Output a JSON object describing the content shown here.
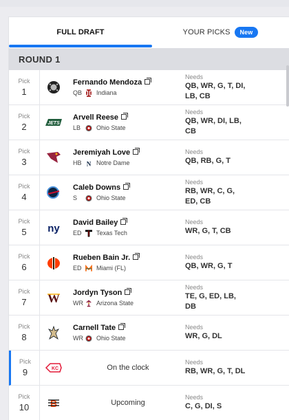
{
  "tabs": {
    "full_draft": "FULL DRAFT",
    "your_picks": "YOUR PICKS",
    "new_badge": "New"
  },
  "round_label": "ROUND 1",
  "pick_label": "Pick",
  "needs_label": "Needs",
  "picks": [
    {
      "num": "1",
      "team_icon": "raiders-logo",
      "name": "Fernando Mendoza",
      "pos": "QB",
      "school": "Indiana",
      "school_icon": "indiana-logo",
      "needs": "QB, WR, G, T, DI, LB, CB"
    },
    {
      "num": "2",
      "team_icon": "jets-logo",
      "name": "Arvell Reese",
      "pos": "LB",
      "school": "Ohio State",
      "school_icon": "ohio-state-logo",
      "needs": "QB, WR, DI, LB, CB"
    },
    {
      "num": "3",
      "team_icon": "cardinals-logo",
      "name": "Jeremiyah Love",
      "pos": "HB",
      "school": "Notre Dame",
      "school_icon": "notre-dame-logo",
      "needs": "QB, RB, G, T"
    },
    {
      "num": "4",
      "team_icon": "titans-logo",
      "name": "Caleb Downs",
      "pos": "S",
      "school": "Ohio State",
      "school_icon": "ohio-state-logo",
      "needs": "RB, WR, C, G, ED, CB"
    },
    {
      "num": "5",
      "team_icon": "giants-logo",
      "name": "David Bailey",
      "pos": "ED",
      "school": "Texas Tech",
      "school_icon": "texas-tech-logo",
      "needs": "WR, G, T, CB"
    },
    {
      "num": "6",
      "team_icon": "browns-logo",
      "name": "Rueben Bain Jr.",
      "pos": "ED",
      "school": "Miami (FL)",
      "school_icon": "miami-logo",
      "needs": "QB, WR, G, T"
    },
    {
      "num": "7",
      "team_icon": "commanders-logo",
      "name": "Jordyn Tyson",
      "pos": "WR",
      "school": "Arizona State",
      "school_icon": "arizona-state-logo",
      "needs": "TE, G, ED, LB, DB"
    },
    {
      "num": "8",
      "team_icon": "saints-logo",
      "name": "Carnell Tate",
      "pos": "WR",
      "school": "Ohio State",
      "school_icon": "ohio-state-logo",
      "needs": "WR, G, DL"
    },
    {
      "num": "9",
      "team_icon": "chiefs-logo",
      "status": "On the clock",
      "needs": "RB, WR, G, T, DL"
    },
    {
      "num": "10",
      "team_icon": "bengals-logo",
      "status": "Upcoming",
      "needs": "C, G, DI, S"
    }
  ],
  "colors": {
    "accent": "#1877f2",
    "round_bg": "#dcdde2"
  }
}
